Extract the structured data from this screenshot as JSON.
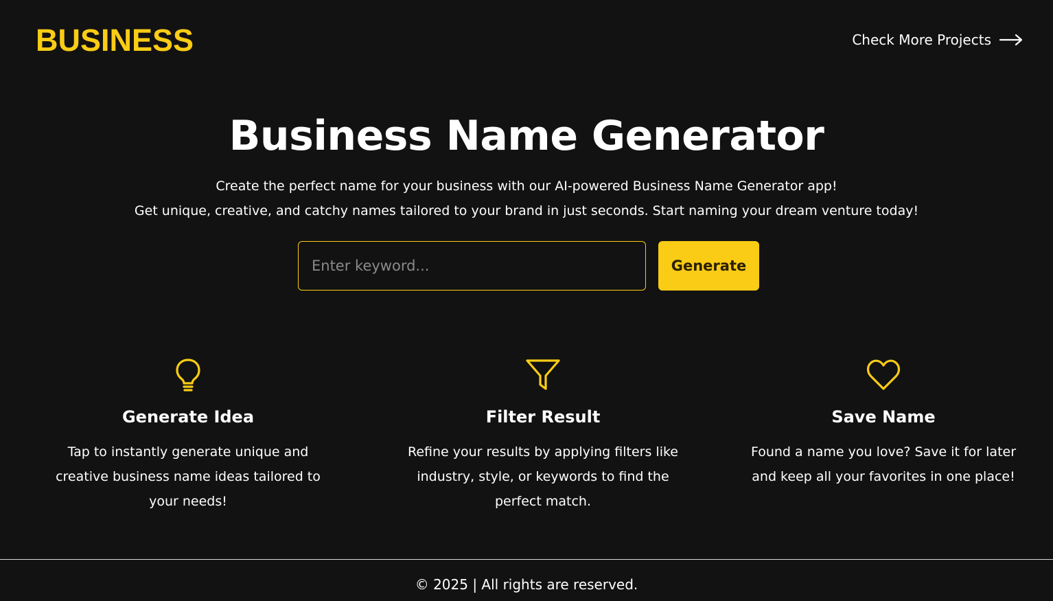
{
  "header": {
    "logo": "BUSINESS",
    "more_link_label": "Check More Projects"
  },
  "hero": {
    "title": "Business Name Generator",
    "subtitle_line1": "Create the perfect name for your business with our AI-powered Business Name Generator app!",
    "subtitle_line2": "Get unique, creative, and catchy names tailored to your brand in just seconds. Start naming your dream venture today!"
  },
  "search": {
    "placeholder": "Enter keyword...",
    "value": "",
    "button_label": "Generate"
  },
  "features": [
    {
      "icon": "lightbulb-icon",
      "title": "Generate Idea",
      "description": "Tap to instantly generate unique and creative business name ideas tailored to your needs!"
    },
    {
      "icon": "filter-icon",
      "title": "Filter Result",
      "description": "Refine your results by applying filters like industry, style, or keywords to find the perfect match."
    },
    {
      "icon": "heart-icon",
      "title": "Save Name",
      "description": "Found a name you love? Save it for later and keep all your favorites in one place!"
    }
  ],
  "footer": {
    "text": "© 2025 | All rights are reserved."
  },
  "colors": {
    "background": "#121212",
    "accent": "#facc15",
    "text": "#ffffff"
  }
}
